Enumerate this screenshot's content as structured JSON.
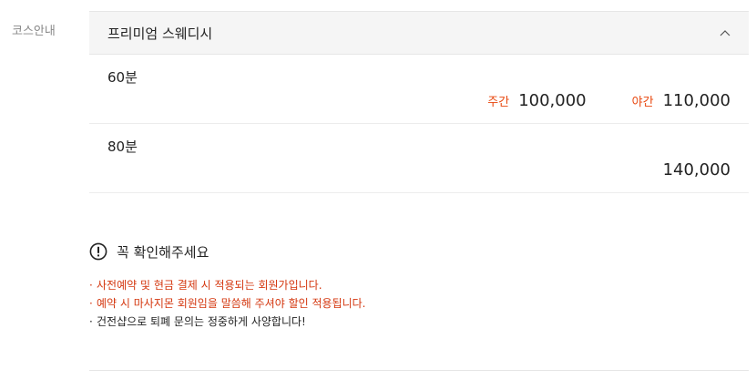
{
  "side_label": "코스안내",
  "course": {
    "title": "프리미엄 스웨디시",
    "options": [
      {
        "duration": "60분",
        "prices": [
          {
            "label": "주간",
            "value": "100,000"
          },
          {
            "label": "야간",
            "value": "110,000"
          }
        ]
      },
      {
        "duration": "80분",
        "prices": [
          {
            "label": "",
            "value": "140,000"
          }
        ]
      }
    ]
  },
  "notice": {
    "title": "꼭 확인해주세요",
    "items": [
      {
        "text": "사전예약 및 현금 결제 시 적용되는 회원가입니다.",
        "color": "#d4370f"
      },
      {
        "text": "예약 시 마사지몬 회원임을 말씀해 주셔야 할인 적용됩니다.",
        "color": "#d4370f"
      },
      {
        "text": "건전샵으로 퇴폐 문의는 정중하게 사양합니다!",
        "color": "#222222"
      }
    ]
  },
  "colors": {
    "accent": "#e8470e",
    "notice_red": "#d4370f",
    "header_bg": "#f5f5f5"
  },
  "icons": {
    "collapse": "chevron-up-icon",
    "notice": "exclamation-circle-icon"
  }
}
